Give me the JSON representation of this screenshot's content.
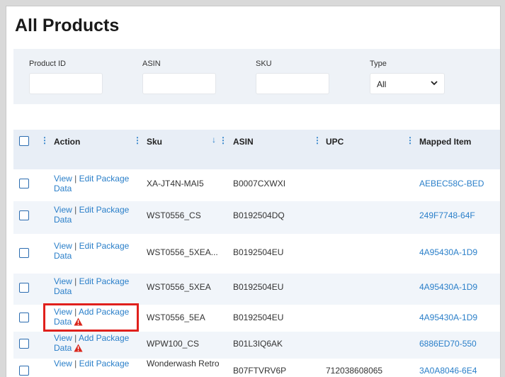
{
  "page": {
    "title": "All Products"
  },
  "filters": {
    "product_id": {
      "label": "Product ID",
      "value": ""
    },
    "asin": {
      "label": "ASIN",
      "value": ""
    },
    "sku": {
      "label": "SKU",
      "value": ""
    },
    "type": {
      "label": "Type",
      "selected": "All"
    }
  },
  "table": {
    "columns": {
      "action": "Action",
      "sku": "Sku",
      "asin": "ASIN",
      "upc": "UPC",
      "mapped": "Mapped Item"
    },
    "rows": [
      {
        "view": "View",
        "sep": "|",
        "edit": "Edit Package",
        "data": "Data",
        "warning": false,
        "sku": "XA-JT4N-MAI5",
        "asin": "B0007CXWXI",
        "upc": "",
        "mapped": "AEBEC58C-BED"
      },
      {
        "view": "View",
        "sep": "|",
        "edit": "Edit Package",
        "data": "Data",
        "warning": false,
        "sku": "WST0556_CS",
        "asin": "B0192504DQ",
        "upc": "",
        "mapped": "249F7748-64F"
      },
      {
        "view": "View",
        "sep": "|",
        "edit": "Edit Package",
        "data": "Data",
        "warning": false,
        "sku": "WST0556_5XEA...",
        "asin": "B0192504EU",
        "upc": "",
        "mapped": "4A95430A-1D9"
      },
      {
        "view": "View",
        "sep": "|",
        "edit": "Edit Package",
        "data": "Data",
        "warning": false,
        "sku": "WST0556_5XEA",
        "asin": "B0192504EU",
        "upc": "",
        "mapped": "4A95430A-1D9"
      },
      {
        "view": "View",
        "sep": "|",
        "edit": "Add Package",
        "data": "Data",
        "warning": true,
        "sku": "WST0556_5EA",
        "asin": "B0192504EU",
        "upc": "",
        "mapped": "4A95430A-1D9"
      },
      {
        "view": "View",
        "sep": "|",
        "edit": "Add Package",
        "data": "Data",
        "warning": true,
        "sku": "WPW100_CS",
        "asin": "B01L3IQ6AK",
        "upc": "",
        "mapped": "6886ED70-550"
      },
      {
        "view": "View",
        "sep": "|",
        "edit": "Edit Package",
        "data": "",
        "warning": false,
        "sku": "Wonderwash Retro",
        "asin": "B07FTVRV6P",
        "upc": "712038608065",
        "mapped": "3A0A8046-6E4"
      }
    ]
  },
  "icons": {
    "warning": "warning-triangle-icon",
    "kebab": "kebab-menu-icon",
    "sort": "sort-down-arrow-icon",
    "dropdown": "chevron-down-icon"
  },
  "colors": {
    "link": "#2a7fc9",
    "header_bg": "#e8eef6",
    "alt_row": "#f1f5fa",
    "warning": "#d9261c",
    "highlight": "#e0201c"
  }
}
